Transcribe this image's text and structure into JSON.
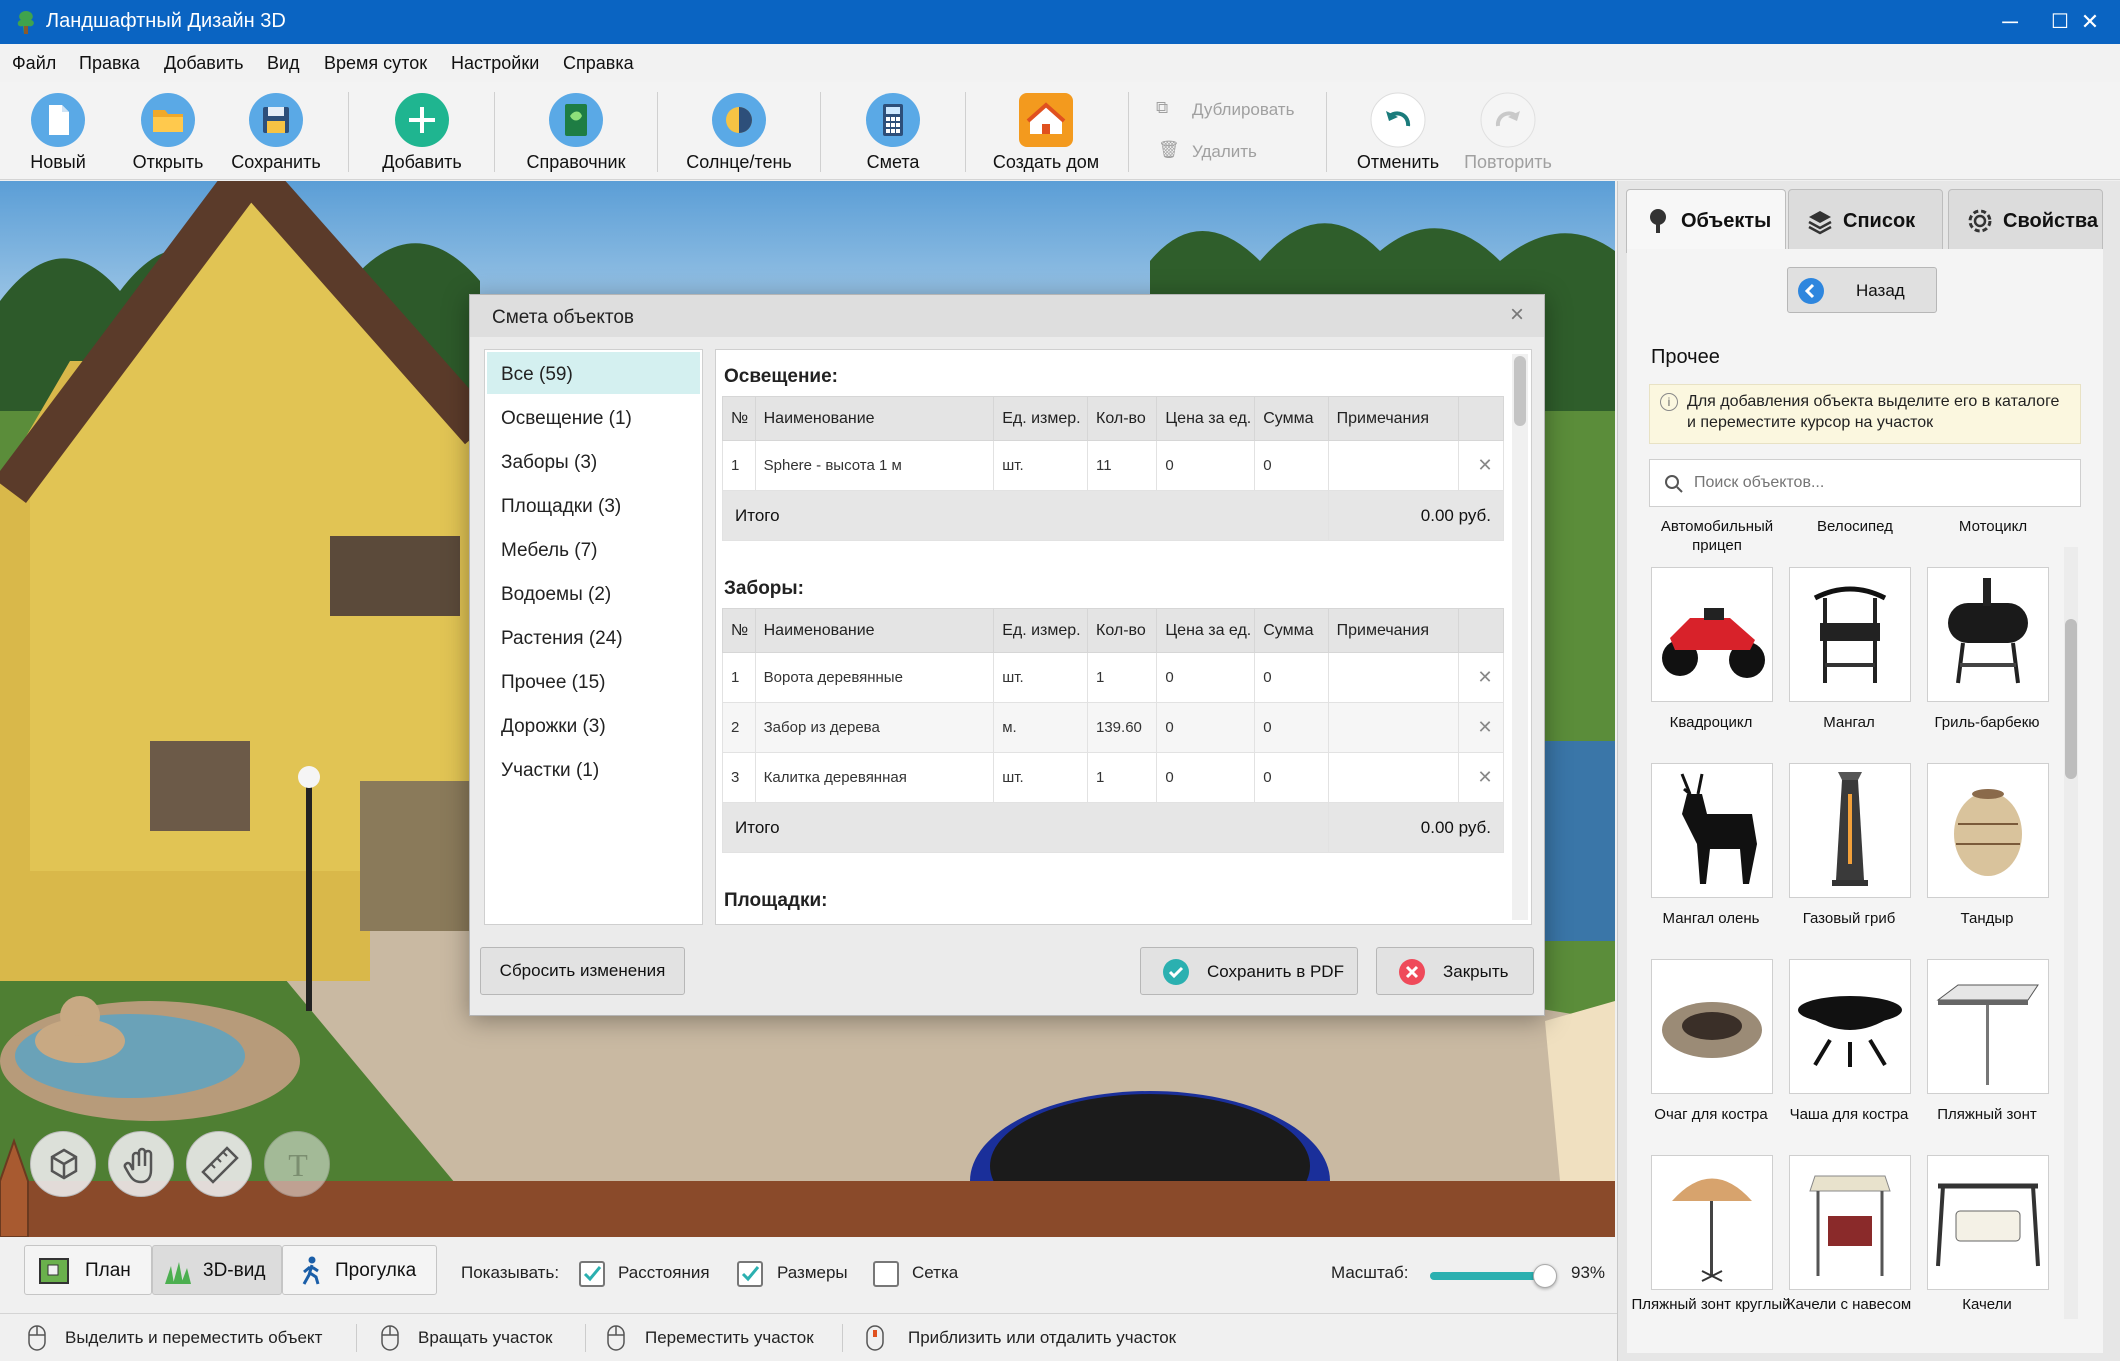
{
  "titlebar": {
    "title": "Ландшафтный Дизайн 3D"
  },
  "menu": [
    "Файл",
    "Правка",
    "Добавить",
    "Вид",
    "Время суток",
    "Настройки",
    "Справка"
  ],
  "toolbar": {
    "new": "Новый",
    "open": "Открыть",
    "save": "Сохранить",
    "add": "Добавить",
    "guide": "Справочник",
    "sun": "Солнце/тень",
    "estimate": "Смета",
    "house": "Создать дом",
    "duplicate": "Дублировать",
    "delete": "Удалить",
    "undo": "Отменить",
    "redo": "Повторить"
  },
  "right_panel": {
    "tabs": [
      "Объекты",
      "Список",
      "Свойства"
    ],
    "back": "Назад",
    "section": "Прочее",
    "hint": "Для добавления объекта выделите его в каталоге и переместите курсор на участок",
    "search_placeholder": "Поиск объектов...",
    "top_labels": [
      "Автомобильный прицеп",
      "Велосипед",
      "Мотоцикл"
    ],
    "items": [
      {
        "name": "Квадроцикл",
        "icon": "atv-icon"
      },
      {
        "name": "Мангал",
        "icon": "brazier-icon"
      },
      {
        "name": "Гриль-барбекю",
        "icon": "grill-icon"
      },
      {
        "name": "Мангал олень",
        "icon": "deer-brazier-icon"
      },
      {
        "name": "Газовый гриб",
        "icon": "gas-heater-icon"
      },
      {
        "name": "Тандыр",
        "icon": "tandoor-icon"
      },
      {
        "name": "Очаг для костра",
        "icon": "fire-pit-icon"
      },
      {
        "name": "Чаша для костра",
        "icon": "fire-bowl-icon"
      },
      {
        "name": "Пляжный зонт",
        "icon": "beach-umbrella-icon"
      },
      {
        "name": "Пляжный зонт круглый",
        "icon": "round-umbrella-icon"
      },
      {
        "name": "Качели с навесом",
        "icon": "canopy-swing-icon"
      },
      {
        "name": "Качели",
        "icon": "swing-icon"
      }
    ]
  },
  "dialog": {
    "title": "Смета объектов",
    "categories": [
      "Все (59)",
      "Освещение (1)",
      "Заборы (3)",
      "Площадки (3)",
      "Мебель (7)",
      "Водоемы (2)",
      "Растения (24)",
      "Прочее (15)",
      "Дорожки (3)",
      "Участки (1)"
    ],
    "columns": [
      "№",
      "Наименование",
      "Ед. измер.",
      "Кол-во",
      "Цена за ед.",
      "Сумма",
      "Примечания"
    ],
    "sections": [
      {
        "title": "Освещение:",
        "rows": [
          [
            "1",
            "Sphere - высота 1 м",
            "шт.",
            "11",
            "0",
            "0",
            ""
          ]
        ],
        "total_label": "Итого",
        "total": "0.00 руб."
      },
      {
        "title": "Заборы:",
        "rows": [
          [
            "1",
            "Ворота деревянные",
            "шт.",
            "1",
            "0",
            "0",
            ""
          ],
          [
            "2",
            "Забор из дерева",
            "м.",
            "139.60",
            "0",
            "0",
            ""
          ],
          [
            "3",
            "Калитка деревянная",
            "шт.",
            "1",
            "0",
            "0",
            ""
          ]
        ],
        "total_label": "Итого",
        "total": "0.00 руб."
      },
      {
        "title": "Площадки:"
      }
    ],
    "reset": "Сбросить изменения",
    "save_pdf": "Сохранить в PDF",
    "close": "Закрыть"
  },
  "bottom": {
    "plan": "План",
    "view3d": "3D-вид",
    "walk": "Прогулка",
    "show": "Показывать:",
    "distances": "Расстояния",
    "sizes": "Размеры",
    "grid": "Сетка",
    "scale_label": "Масштаб:",
    "scale": "93%",
    "scale_value": 0.93
  },
  "status": [
    "Выделить и переместить объект",
    "Вращать участок",
    "Переместить участок",
    "Приблизить или отдалить участок"
  ],
  "colors": {
    "titlebar": "#0a64c2",
    "accent": "#2bb0b0"
  }
}
